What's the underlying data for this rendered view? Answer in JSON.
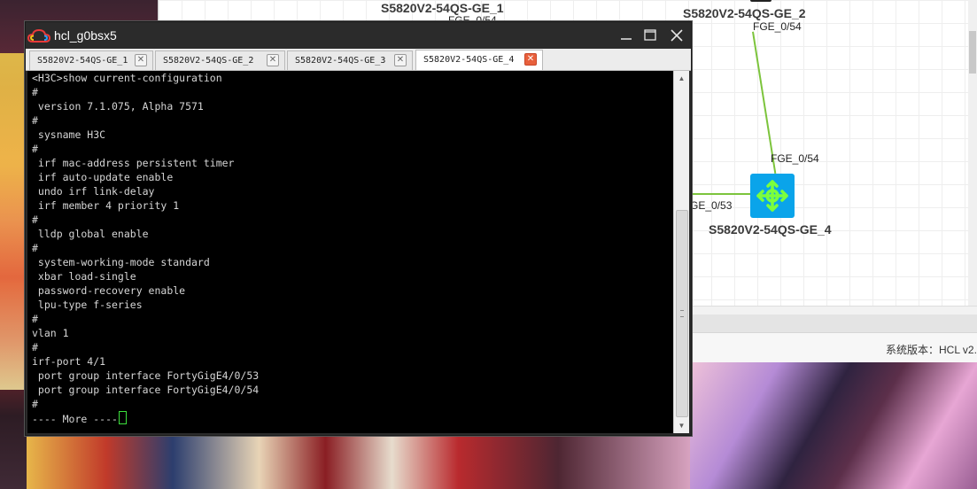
{
  "hcl": {
    "devices": [
      {
        "name": "S5820V2-54QS-GE_1"
      },
      {
        "name": "S5820V2-54QS-GE_2"
      },
      {
        "name": "S5820V2-54QS-GE_4"
      }
    ],
    "ports": {
      "dev1_port": "FGE_0/54",
      "dev2_port": "FGE_0/54",
      "dev4_top_port": "FGE_0/54",
      "dev4_left_port": "GE_0/53"
    },
    "switch_icon": "router-switch-icon",
    "link_color": "#7cc43c",
    "switch_color": "#0aa4ea",
    "status_version": "系统版本：HCL v2."
  },
  "terminal": {
    "title": "hcl_g0bsx5",
    "tabs": [
      {
        "label": "S5820V2-54QS-GE_1",
        "active": false
      },
      {
        "label": "S5820V2-54QS-GE_2",
        "active": false
      },
      {
        "label": "S5820V2-54QS-GE_3",
        "active": false
      },
      {
        "label": "S5820V2-54QS-GE_4",
        "active": true
      }
    ],
    "lines": [
      "<H3C>show current-configuration",
      "#",
      " version 7.1.075, Alpha 7571",
      "#",
      " sysname H3C",
      "#",
      " irf mac-address persistent timer",
      " irf auto-update enable",
      " undo irf link-delay",
      " irf member 4 priority 1",
      "#",
      " lldp global enable",
      "#",
      " system-working-mode standard",
      " xbar load-single",
      " password-recovery enable",
      " lpu-type f-series",
      "#",
      "vlan 1",
      "#",
      "irf-port 4/1",
      " port group interface FortyGigE4/0/53",
      " port group interface FortyGigE4/0/54",
      "#"
    ],
    "more_prompt": "---- More ----",
    "cursor_color": "#3ce03c",
    "icons": {
      "app": "cloud-icon",
      "minimize": "minimize-icon",
      "maximize": "maximize-icon",
      "close": "close-icon"
    }
  }
}
